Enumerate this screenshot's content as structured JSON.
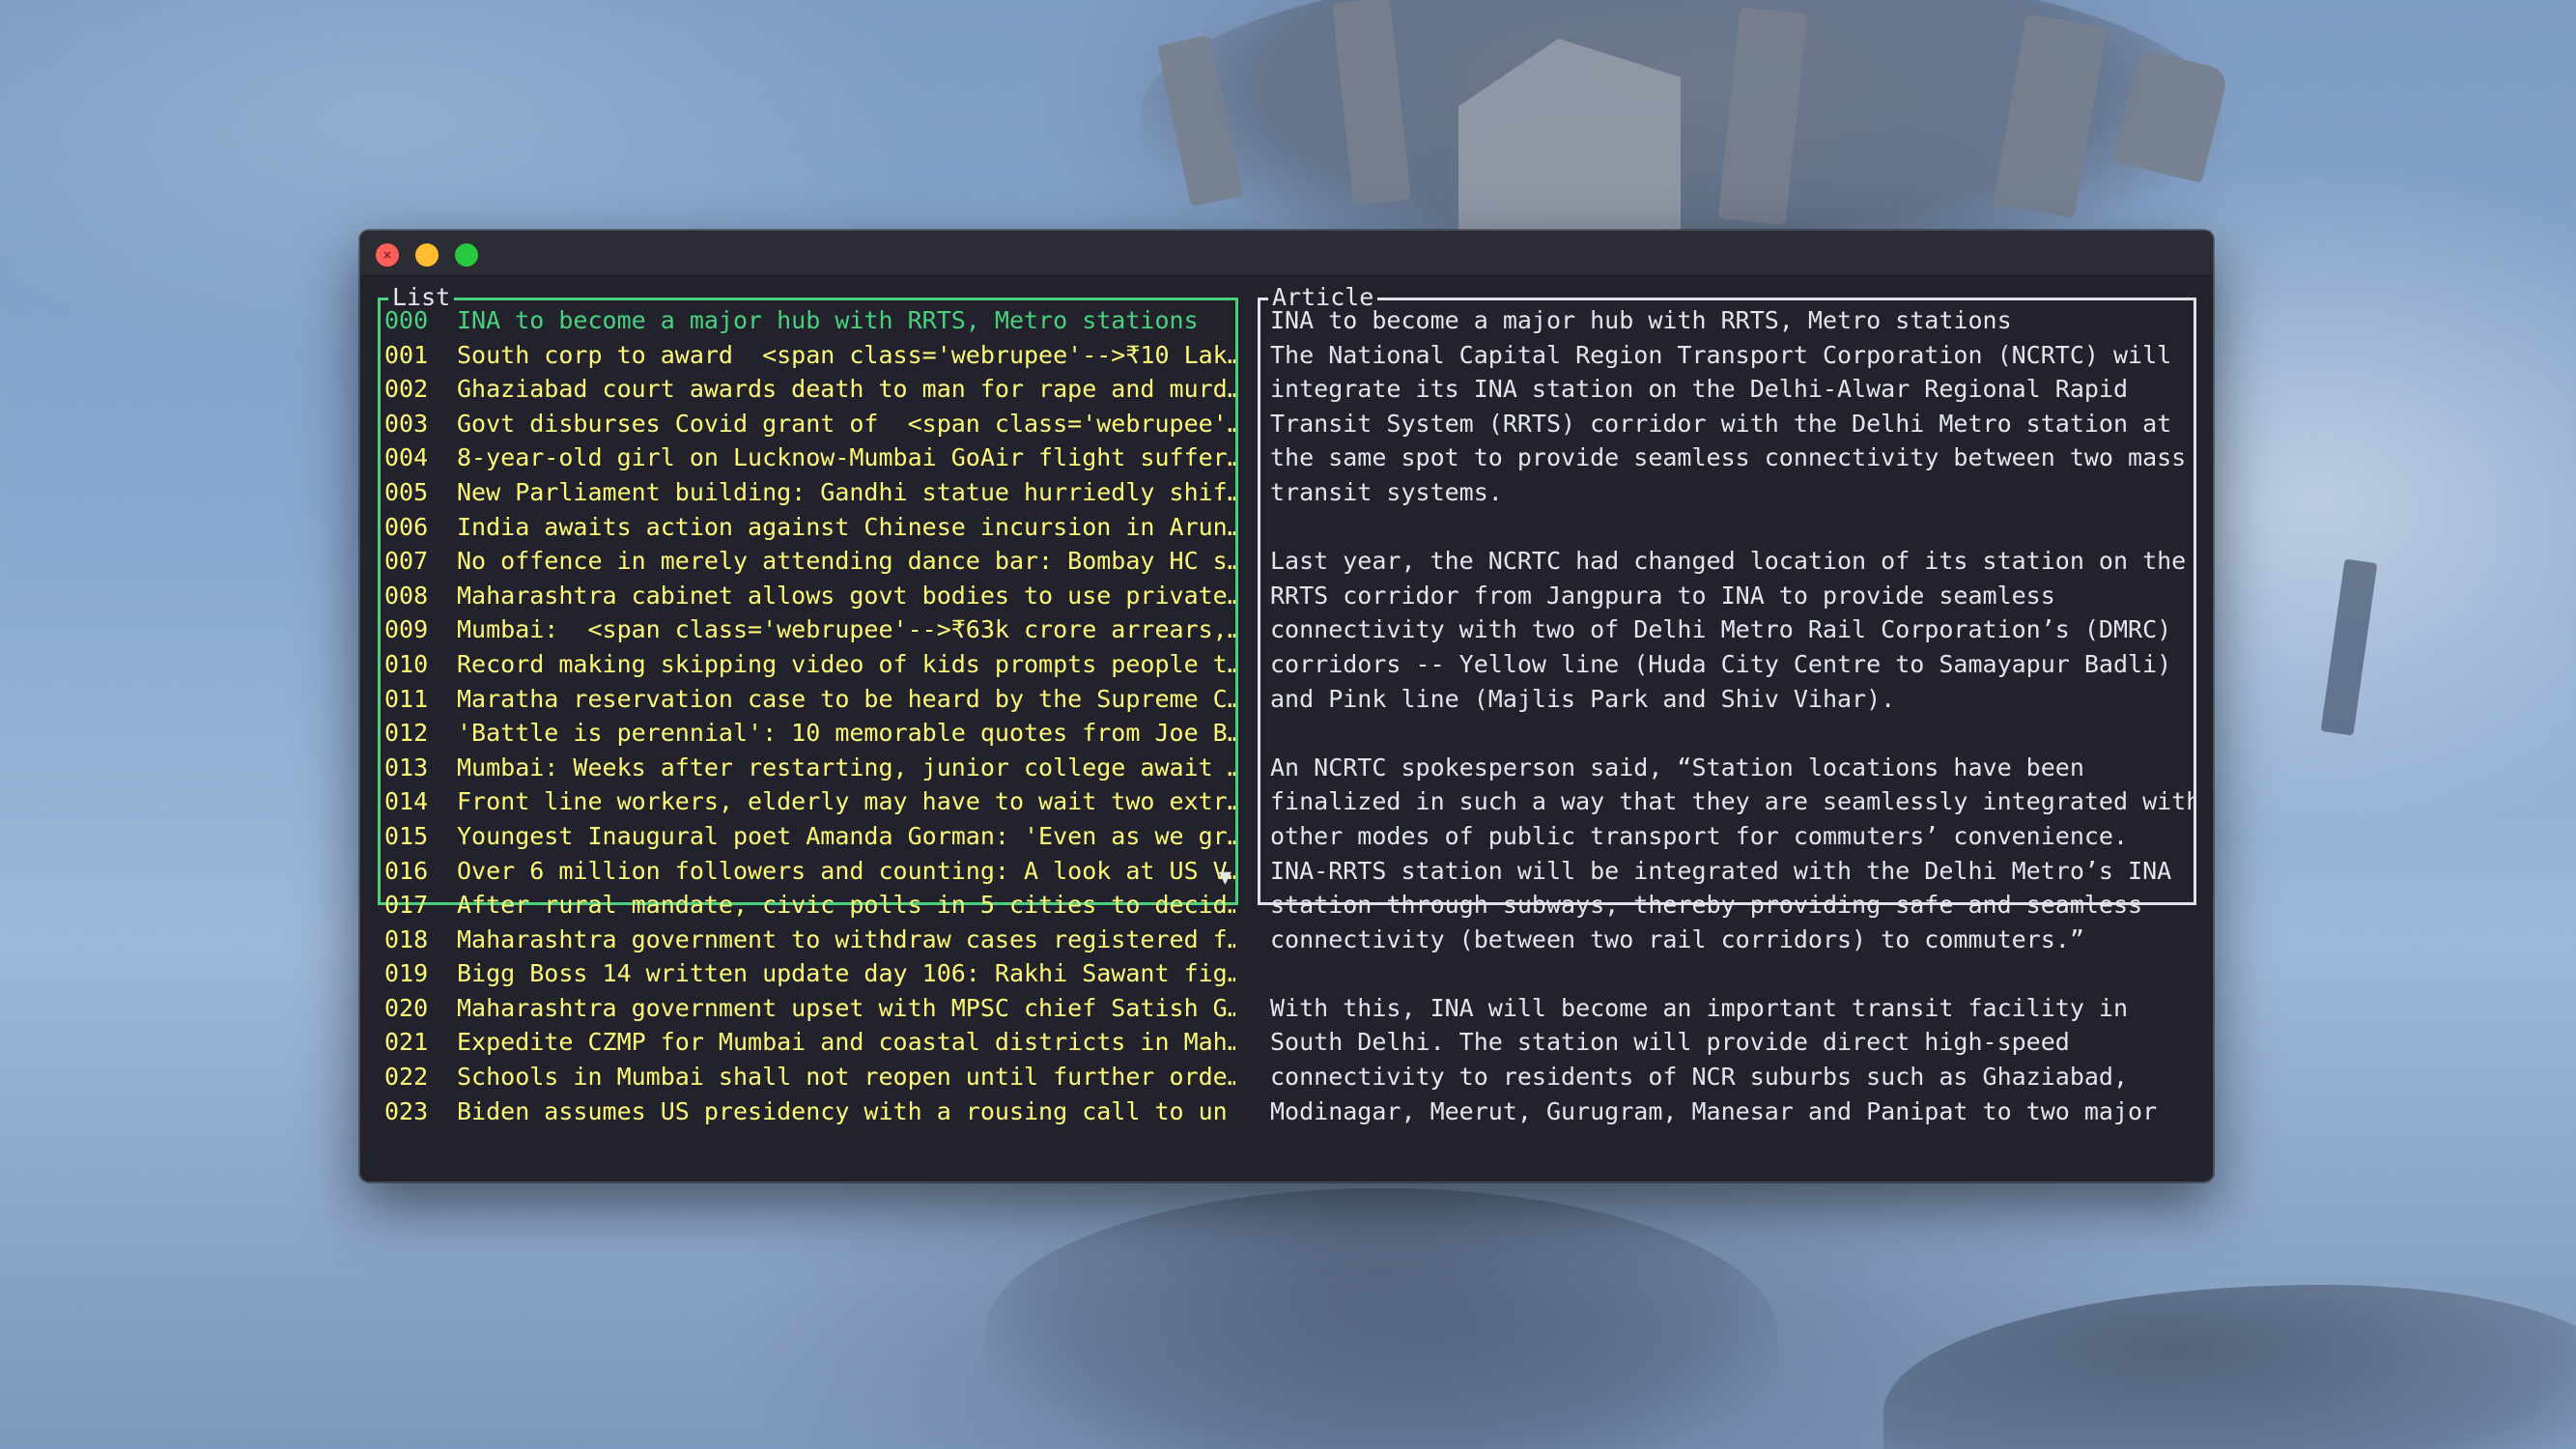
{
  "window": {
    "controls": {
      "close_glyph": "×",
      "close_color": "#fe5f57",
      "minimize_color": "#febc2e",
      "zoom_color": "#28c840"
    }
  },
  "colors": {
    "terminal_bg": "#21222c",
    "list_text": "#fdf777",
    "list_selected": "#49d17e",
    "list_border": "#49d17e",
    "article_text": "#e3e5ea",
    "article_border": "#dfe1e5"
  },
  "list": {
    "title": "List",
    "selected_index": 0,
    "items": [
      {
        "index": "000",
        "title": "INA to become a major hub with RRTS, Metro stations"
      },
      {
        "index": "001",
        "title": "South corp to award  <span class='webrupee'-->₹10 Lak…"
      },
      {
        "index": "002",
        "title": "Ghaziabad court awards death to man for rape and murd…"
      },
      {
        "index": "003",
        "title": "Govt disburses Covid grant of  <span class='webrupee'…"
      },
      {
        "index": "004",
        "title": "8-year-old girl on Lucknow-Mumbai GoAir flight suffer…"
      },
      {
        "index": "005",
        "title": "New Parliament building: Gandhi statue hurriedly shif…"
      },
      {
        "index": "006",
        "title": "India awaits action against Chinese incursion in Arun…"
      },
      {
        "index": "007",
        "title": "No offence in merely attending dance bar: Bombay HC s…"
      },
      {
        "index": "008",
        "title": "Maharashtra cabinet allows govt bodies to use private…"
      },
      {
        "index": "009",
        "title": "Mumbai:  <span class='webrupee'-->₹63k crore arrears,…"
      },
      {
        "index": "010",
        "title": "Record making skipping video of kids prompts people t…"
      },
      {
        "index": "011",
        "title": "Maratha reservation case to be heard by the Supreme C…"
      },
      {
        "index": "012",
        "title": "'Battle is perennial': 10 memorable quotes from Joe B…"
      },
      {
        "index": "013",
        "title": "Mumbai: Weeks after restarting, junior college await …"
      },
      {
        "index": "014",
        "title": "Front line workers, elderly may have to wait two extr…"
      },
      {
        "index": "015",
        "title": "Youngest Inaugural poet Amanda Gorman: 'Even as we gr…"
      },
      {
        "index": "016",
        "title": "Over 6 million followers and counting: A look at US V…"
      },
      {
        "index": "017",
        "title": "After rural mandate, civic polls in 5 cities to decid…"
      },
      {
        "index": "018",
        "title": "Maharashtra government to withdraw cases registered f…"
      },
      {
        "index": "019",
        "title": "Bigg Boss 14 written update day 106: Rakhi Sawant fig…"
      },
      {
        "index": "020",
        "title": "Maharashtra government upset with MPSC chief Satish G…"
      },
      {
        "index": "021",
        "title": "Expedite CZMP for Mumbai and coastal districts in Mah…"
      },
      {
        "index": "022",
        "title": "Schools in Mumbai shall not reopen until further orde…"
      },
      {
        "index": "023",
        "title": "Biden assumes US presidency with a rousing call to un"
      }
    ],
    "scroll_indicator": "▼"
  },
  "article": {
    "title": "Article",
    "lines": [
      "INA to become a major hub with RRTS, Metro stations",
      "The National Capital Region Transport Corporation (NCRTC) will",
      "integrate its INA station on the Delhi-Alwar Regional Rapid",
      "Transit System (RRTS) corridor with the Delhi Metro station at",
      "the same spot to provide seamless connectivity between two mass",
      "transit systems.",
      "",
      "Last year, the NCRTC had changed location of its station on the",
      "RRTS corridor from Jangpura to INA to provide seamless",
      "connectivity with two of Delhi Metro Rail Corporation’s (DMRC)",
      "corridors -- Yellow line (Huda City Centre to Samayapur Badli)",
      "and Pink line (Majlis Park and Shiv Vihar).",
      "",
      "An NCRTC spokesperson said, “Station locations have been",
      "finalized in such a way that they are seamlessly integrated with",
      "other modes of public transport for commuters’ convenience.",
      "INA-RRTS station will be integrated with the Delhi Metro’s INA",
      "station through subways, thereby providing safe and seamless",
      "connectivity (between two rail corridors) to commuters.”",
      "",
      "With this, INA will become an important transit facility in",
      "South Delhi. The station will provide direct high-speed",
      "connectivity to residents of NCR suburbs such as Ghaziabad,",
      "Modinagar, Meerut, Gurugram, Manesar and Panipat to two major"
    ]
  }
}
